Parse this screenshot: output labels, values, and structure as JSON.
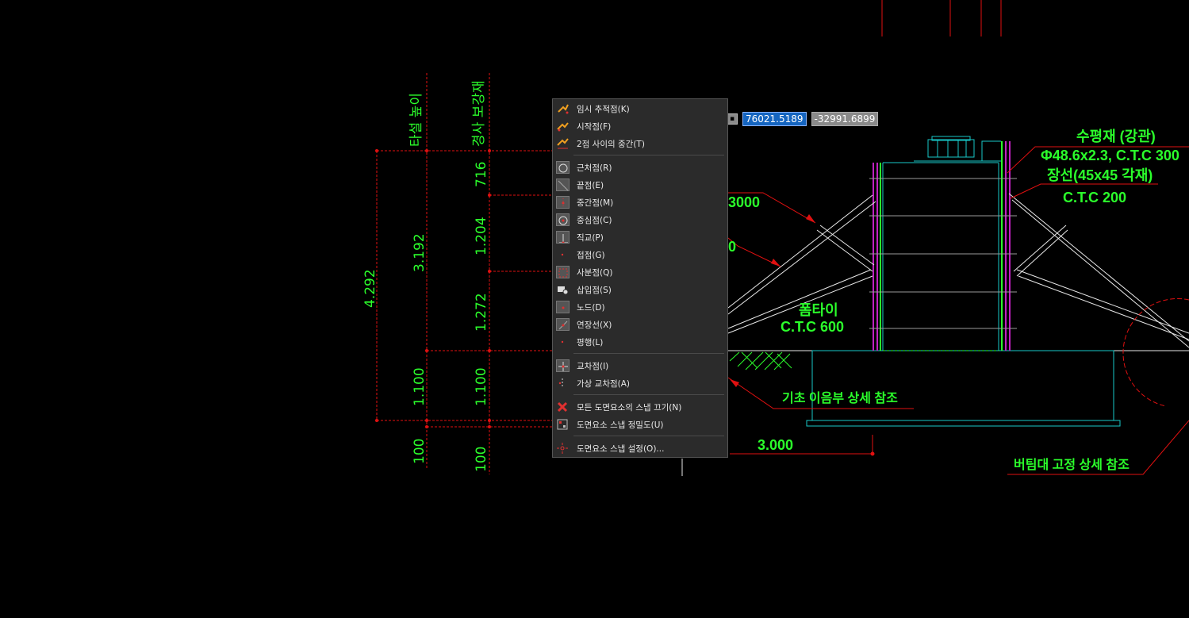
{
  "coordinates": {
    "x": "76021.5189",
    "y": "-32991.6899"
  },
  "drawing": {
    "vertical_headers": [
      "타설 높이",
      "경사 보강재"
    ],
    "dims_col1": [
      "4.292"
    ],
    "dims_col2": [
      "3.192",
      "1.100",
      "100"
    ],
    "dims_col3": [
      "716",
      "1.204",
      "1.272",
      "1.100",
      "100"
    ],
    "labels": {
      "horizontal_member": "수평재 (강관)",
      "pipe_spec": "Φ48.6x2.3, C.T.C 300",
      "long_bar": "장선(45x45 각재)",
      "long_bar_ctc": "C.T.C 200",
      "form_tie": "폼타이",
      "form_tie_ctc": "C.T.C 600",
      "foundation_ref": "기초 이음부 상세 참조",
      "brace_ref": "버팀대 고정 상세 참조",
      "dim_3000": "3.000",
      "partial_3000": "3000",
      "partial_0": "0"
    }
  },
  "context_menu": {
    "groups": [
      [
        {
          "label": "임시 추적점(K)",
          "icon": "temp-track-icon"
        },
        {
          "label": "시작점(F)",
          "icon": "from-point-icon"
        },
        {
          "label": "2점 사이의 중간(T)",
          "icon": "mid-between-icon"
        }
      ],
      [
        {
          "label": "근처점(R)",
          "icon": "nearest-icon"
        },
        {
          "label": "끝점(E)",
          "icon": "endpoint-icon"
        },
        {
          "label": "중간점(M)",
          "icon": "midpoint-icon"
        },
        {
          "label": "중심점(C)",
          "icon": "center-icon"
        },
        {
          "label": "직교(P)",
          "icon": "perpendicular-icon"
        },
        {
          "label": "접점(G)",
          "icon": "tangent-icon"
        },
        {
          "label": "사분점(Q)",
          "icon": "quadrant-icon"
        },
        {
          "label": "삽입점(S)",
          "icon": "insertion-icon"
        },
        {
          "label": "노드(D)",
          "icon": "node-icon"
        },
        {
          "label": "연장선(X)",
          "icon": "extension-icon"
        },
        {
          "label": "평행(L)",
          "icon": "parallel-icon"
        }
      ],
      [
        {
          "label": "교차점(I)",
          "icon": "intersection-icon"
        },
        {
          "label": "가상 교차점(A)",
          "icon": "apparent-intersection-icon"
        }
      ],
      [
        {
          "label": "모든 도면요소의 스냅 끄기(N)",
          "icon": "snap-off-icon"
        },
        {
          "label": "도면요소 스냅 정밀도(U)",
          "icon": "snap-precision-icon"
        }
      ],
      [
        {
          "label": "도면요소 스냅 설정(O)...",
          "icon": "snap-settings-icon"
        }
      ]
    ]
  }
}
